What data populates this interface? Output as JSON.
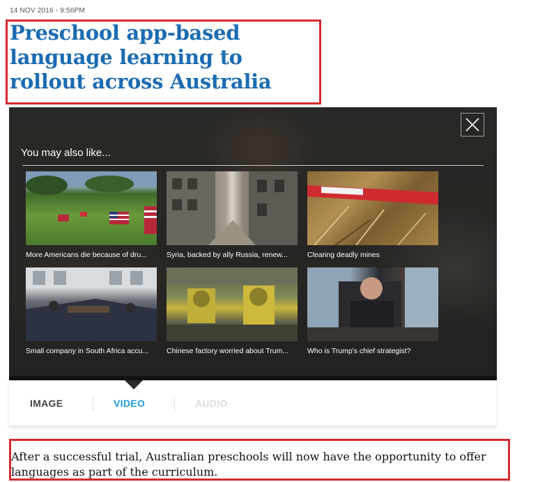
{
  "article": {
    "timestamp": "14 NOV 2016 - 9:56PM",
    "headline": "Preschool app-based language learning to rollout across Australia",
    "summary": "After a successful trial, Australian preschools will now have the opportunity to offer languages as part of the curriculum."
  },
  "related": {
    "title": "You may also like...",
    "close_icon": "close-icon",
    "items": [
      {
        "caption": "More Americans die because of dru..."
      },
      {
        "caption": "Syria, backed by ally Russia, renew..."
      },
      {
        "caption": "Clearing deadly mines"
      },
      {
        "caption": "Small company in South Africa accu..."
      },
      {
        "caption": "Chinese factory worried about Trum..."
      },
      {
        "caption": "Who is Trump's chief strategist?"
      }
    ]
  },
  "media_tabs": {
    "image": "IMAGE",
    "video": "VIDEO",
    "audio": "AUDIO",
    "active": "VIDEO",
    "active_color": "#1e9bd7"
  },
  "colors": {
    "headline": "#1b6cb3",
    "highlight_border": "#d42a2f"
  }
}
